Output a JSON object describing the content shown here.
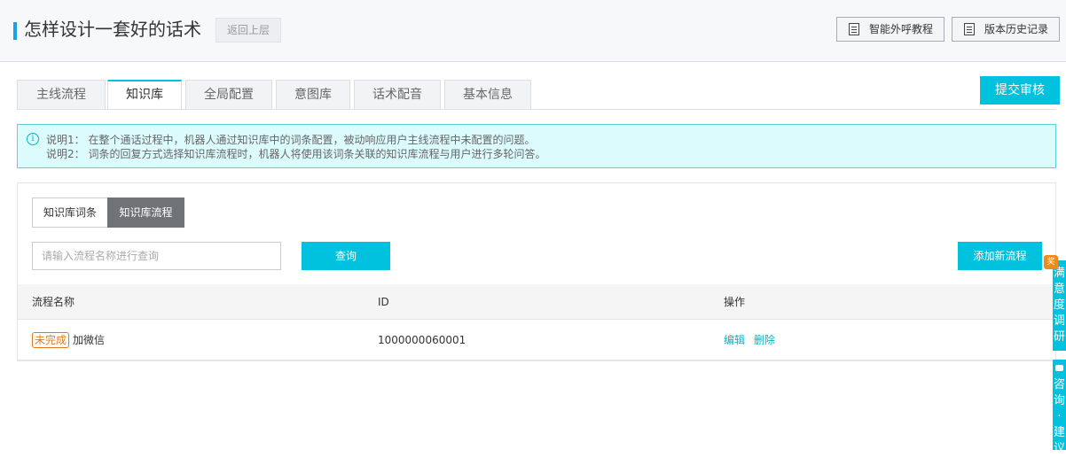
{
  "header": {
    "title": "怎样设计一套好的话术",
    "back_label": "返回上层",
    "tutorial_label": "智能外呼教程",
    "history_label": "版本历史记录"
  },
  "tabs": [
    {
      "label": "主线流程",
      "active": false
    },
    {
      "label": "知识库",
      "active": true
    },
    {
      "label": "全局配置",
      "active": false
    },
    {
      "label": "意图库",
      "active": false
    },
    {
      "label": "话术配音",
      "active": false
    },
    {
      "label": "基本信息",
      "active": false
    }
  ],
  "submit_label": "提交审核",
  "notice": {
    "line1": "说明1： 在整个通话过程中，机器人通过知识库中的词条配置，被动响应用户主线流程中未配置的问题。",
    "line2": "说明2： 词条的回复方式选择知识库流程时，机器人将使用该词条关联的知识库流程与用户进行多轮问答。"
  },
  "segments": {
    "terms_label": "知识库词条",
    "flows_label": "知识库流程",
    "selected": "知识库流程"
  },
  "search": {
    "placeholder": "请输入流程名称进行查询",
    "value": "",
    "query_label": "查询",
    "add_label": "添加新流程"
  },
  "table": {
    "columns": [
      "流程名称",
      "ID",
      "操作"
    ],
    "rows": [
      {
        "status": "未完成",
        "name": "加微信",
        "id": "1000000060001",
        "actions": [
          "编辑",
          "删除"
        ]
      }
    ]
  },
  "side": {
    "badge": "奖",
    "survey_label": "满意度调研",
    "consult_label": "咨询·建议"
  },
  "colors": {
    "accent": "#00c1de",
    "title_bar": "#1aa0e6",
    "status_warning": "#e07a18"
  }
}
